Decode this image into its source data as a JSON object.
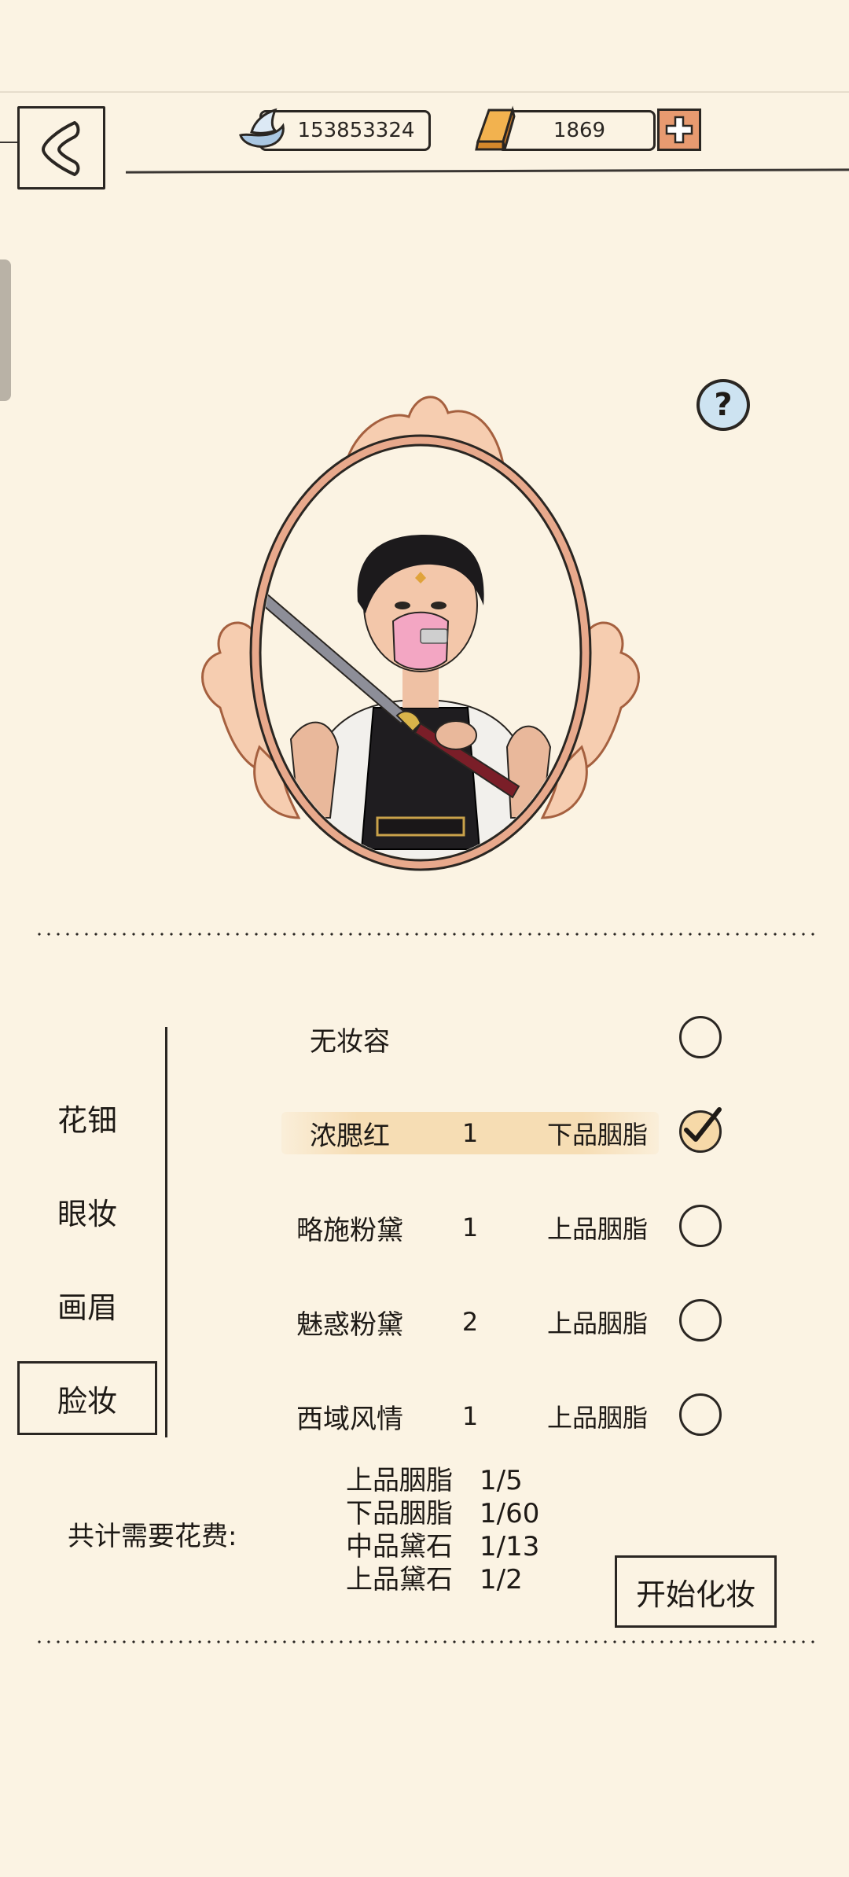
{
  "currency": {
    "silver_amount": "153853324",
    "gold_amount": "1869"
  },
  "icons": {
    "back": "back-arrow-icon",
    "silver": "silver-ingot-icon",
    "gold": "gold-bar-icon",
    "plus": "plus-icon",
    "help": "question-mark-icon"
  },
  "help_label": "?",
  "categories": [
    {
      "label": "花钿"
    },
    {
      "label": "眼妆"
    },
    {
      "label": "画眉"
    },
    {
      "label": "脸妆",
      "active": true
    }
  ],
  "options": [
    {
      "name": "无妆容",
      "qty": "",
      "material": "",
      "selected": false
    },
    {
      "name": "浓腮红",
      "qty": "1",
      "material": "下品胭脂",
      "selected": true
    },
    {
      "name": "略施粉黛",
      "qty": "1",
      "material": "上品胭脂",
      "selected": false
    },
    {
      "name": "魅惑粉黛",
      "qty": "2",
      "material": "上品胭脂",
      "selected": false
    },
    {
      "name": "西域风情",
      "qty": "1",
      "material": "上品胭脂",
      "selected": false
    }
  ],
  "cost": {
    "label": "共计需要花费:",
    "items": [
      {
        "name": "上品胭脂",
        "value": "1/5"
      },
      {
        "name": "下品胭脂",
        "value": "1/60"
      },
      {
        "name": "中品黛石",
        "value": "1/13"
      },
      {
        "name": "上品黛石",
        "value": "1/2"
      }
    ]
  },
  "start_button_label": "开始化妆",
  "colors": {
    "background": "#fbf3e3",
    "ink": "#2a2622",
    "frame": "#e8a98c",
    "plus_button": "#e79a70",
    "help_button": "#cde3f1",
    "selected_highlight": "#f6dcb2"
  }
}
